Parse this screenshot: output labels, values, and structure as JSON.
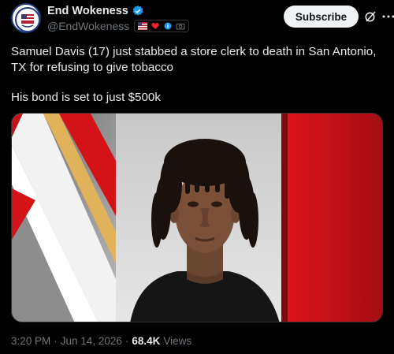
{
  "author": {
    "display_name": "End Wokeness",
    "handle": "@EndWokeness",
    "verified": true,
    "badges": [
      "us-flag-icon",
      "heart-icon",
      "info-icon",
      "camera-icon"
    ]
  },
  "actions": {
    "subscribe_label": "Subscribe",
    "grok_icon": "grok-icon",
    "more_icon": "more-dots-icon"
  },
  "tweet": {
    "line1": "Samuel Davis (17) just stabbed a store clerk to death in San Antonio, TX for refusing to give tobacco",
    "line2": "His bond is set to just $500k"
  },
  "media": {
    "description_icon": "mugshot-image",
    "colors": {
      "red": "#c4121a",
      "dark_red": "#7a0b0e",
      "gray": "#d8d8d8",
      "white": "#ffffff",
      "gold": "#e0b25a"
    }
  },
  "meta": {
    "time": "3:20 PM",
    "separator": "·",
    "date": "Jun 14, 2026",
    "views_count": "68.4K",
    "views_label": "Views"
  }
}
